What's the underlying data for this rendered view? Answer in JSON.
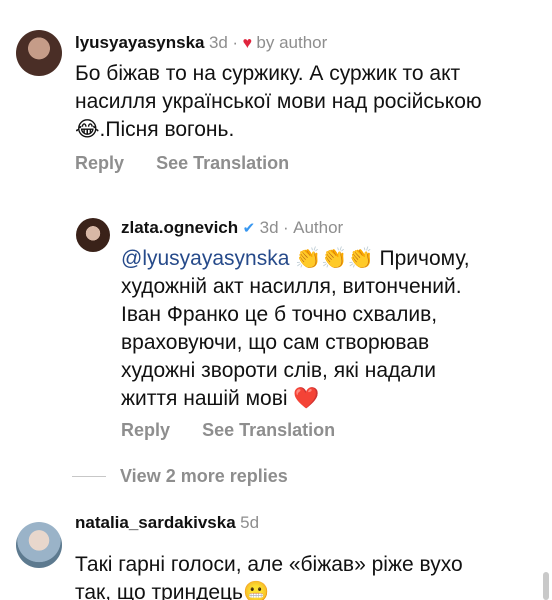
{
  "comments": [
    {
      "username": "lyusyayasynska",
      "time": "3d",
      "separator": "·",
      "liked_by": "by author",
      "text_lines": [
        "Бо біжав то на суржику. А суржик то акт",
        "насилля української мови над російською",
        ".Пісня вогонь."
      ],
      "emoji": "😂",
      "reply_label": "Reply",
      "translate_label": "See Translation"
    },
    {
      "username": "zlata.ognevich",
      "time": "3d",
      "separator": "·",
      "role": "Author",
      "mention": "@lyusyayasynska",
      "clap_emoji": "👏👏👏",
      "text_line1_rest": " Причому,",
      "text_lines": [
        "художній акт насилля, витончений.",
        "Іван Франко це б точно схвалив,",
        "враховуючи, що сам створював",
        "художні звороти слів, які надали",
        "життя нашій мові "
      ],
      "heart_emoji": "❤️",
      "reply_label": "Reply",
      "translate_label": "See Translation"
    },
    {
      "username": "natalia_sardakivska",
      "time": "5d",
      "text_lines": [
        "Такі гарні голоси, але «біжав» ріже вухо",
        "так, що триндець"
      ],
      "emoji": "😬"
    }
  ],
  "view_more_label": "View 2 more replies",
  "colors": {
    "mention": "#264a8a",
    "heart": "#e0243d",
    "meta": "#8e8e8e"
  }
}
